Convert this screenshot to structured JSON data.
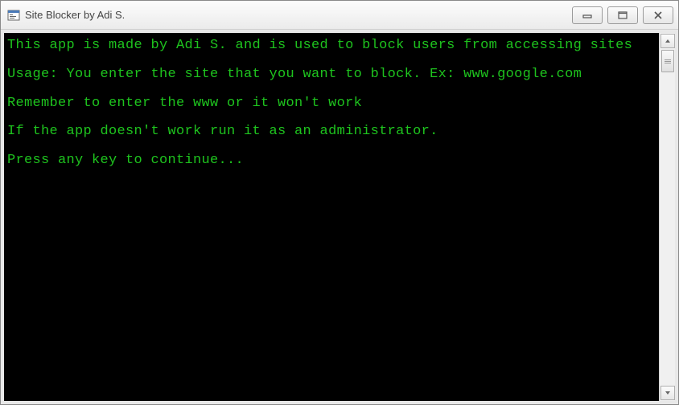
{
  "window": {
    "title": "Site Blocker by Adi S."
  },
  "console": {
    "lines": [
      "This app is made by Adi S. and is used to block users from accessing sites",
      "Usage: You enter the site that you want to block. Ex: www.google.com",
      "Remember to enter the www or it won't work",
      "If the app doesn't work run it as an administrator.",
      "Press any key to continue..."
    ]
  }
}
